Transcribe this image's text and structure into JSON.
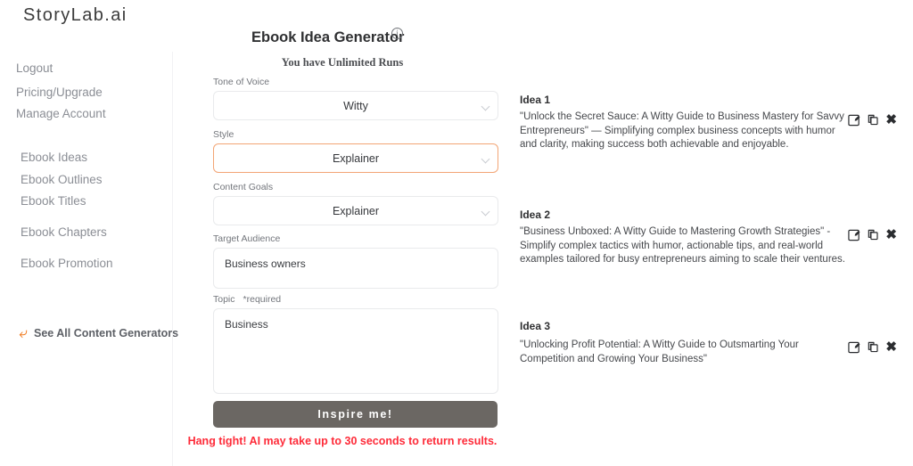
{
  "brand": {
    "logo": "StoryLab.ai"
  },
  "sidebar": {
    "account_links": [
      {
        "label": "Logout",
        "name": "logout"
      },
      {
        "label": "Pricing/Upgrade",
        "name": "pricing-upgrade"
      },
      {
        "label": "Manage Account",
        "name": "manage-account"
      }
    ],
    "generators": [
      {
        "label": "Ebook Ideas",
        "name": "ebook-ideas"
      },
      {
        "label": "Ebook Outlines",
        "name": "ebook-outlines"
      },
      {
        "label": "Ebook Titles",
        "name": "ebook-titles"
      },
      {
        "label": "Ebook Chapters",
        "name": "ebook-chapters"
      },
      {
        "label": "Ebook Promotion",
        "name": "ebook-promotion"
      }
    ],
    "see_all": {
      "label": "See All Content Generators",
      "icon": "back-arrow-icon",
      "color": "#f07c22"
    }
  },
  "header": {
    "title": "Ebook Idea Generator",
    "info_icon": "info-icon",
    "runs_text": "You have Unlimited Runs"
  },
  "form": {
    "tone_of_voice": {
      "label": "Tone of Voice",
      "value": "Witty"
    },
    "style": {
      "label": "Style",
      "value": "Explainer",
      "focused": true
    },
    "content_goals": {
      "label": "Content Goals",
      "value": "Explainer"
    },
    "target_audience": {
      "label": "Target Audience",
      "value": "Business owners",
      "placeholder": ""
    },
    "topic": {
      "label": "Topic",
      "required_note": "*required",
      "value": "Business",
      "placeholder": ""
    },
    "submit_label": "Inspire me!",
    "notice": "Hang tight! AI may take up to 30 seconds to return results."
  },
  "results": {
    "ideas": [
      {
        "title": "Idea 1",
        "text": "\"Unlock the Secret Sauce: A Witty Guide to Business Mastery for Savvy Entrepreneurs\" — Simplifying complex business concepts with humor and clarity, making success both achievable and enjoyable."
      },
      {
        "title": "Idea 2",
        "text": "\"Business Unboxed: A Witty Guide to Mastering Growth Strategies\" - Simplify complex tactics with humor, actionable tips, and real-world examples tailored for busy entrepreneurs aiming to scale their ventures."
      },
      {
        "title": "Idea 3",
        "text": "\"Unlocking Profit Potential: A Witty Guide to Outsmarting Your Competition and Growing Your Business\""
      }
    ],
    "actions": {
      "edit": "edit-icon",
      "copy": "copy-icon",
      "close": "close-icon",
      "close_glyph": "✖"
    }
  },
  "colors": {
    "accent_orange": "#f07c22",
    "focus_border": "#f3a575",
    "button_gray": "#6b6763",
    "warning_red": "#fe2b39"
  }
}
